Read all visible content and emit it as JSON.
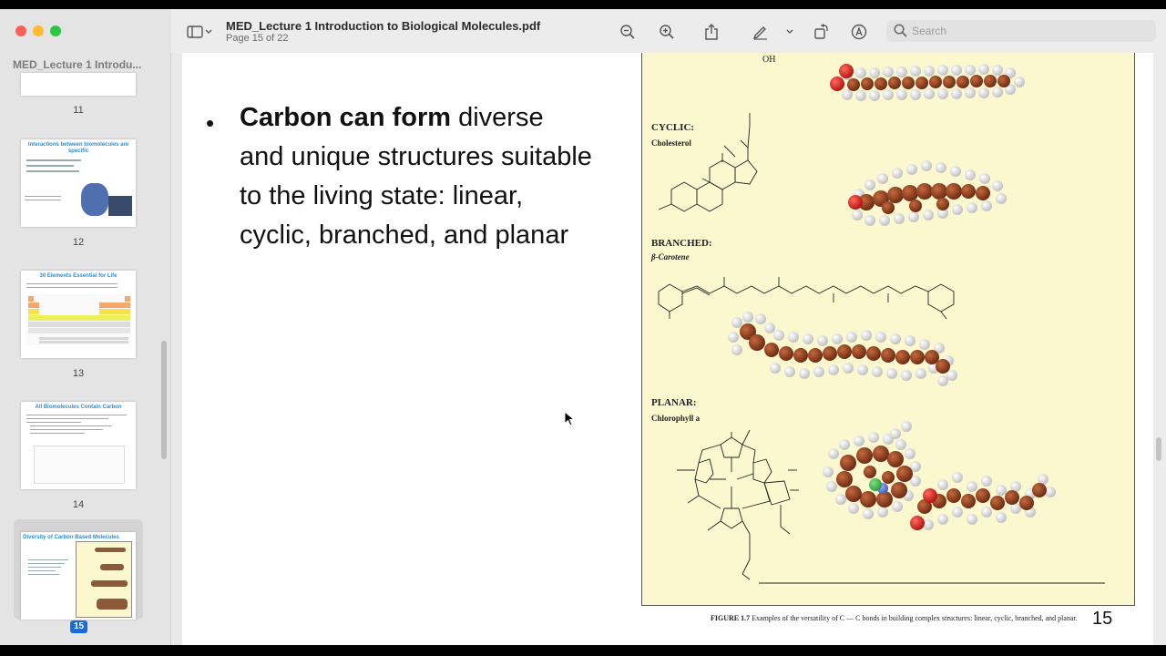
{
  "window": {
    "title": "MED_Lecture 1 Introduction to Biological Molecules.pdf",
    "page_indicator": "Page 15 of 22",
    "search_placeholder": "Search"
  },
  "toolbar": {
    "icons": [
      "sidebar-toggle-icon",
      "chevron-down-icon",
      "zoom-out-icon",
      "zoom-in-icon",
      "share-icon",
      "markup-pen-icon",
      "chevron-down-icon",
      "rotate-icon",
      "annotate-icon",
      "search-icon"
    ]
  },
  "sidebar": {
    "title": "MED_Lecture 1 Introdu...",
    "thumbnails": [
      {
        "page": "11",
        "title": ""
      },
      {
        "page": "12",
        "title": "Interactions between biomolecules are specific"
      },
      {
        "page": "13",
        "title": "30 Elements Essential for Life"
      },
      {
        "page": "14",
        "title": "All Biomolecules Contain Carbon"
      },
      {
        "page": "15",
        "title": "Diversity of Carbon Based Molecules",
        "selected": true
      }
    ]
  },
  "slide": {
    "bullet_bold": "Carbon can form",
    "bullet_rest": " diverse and unique structures suitable to the living state: linear, cyclic, branched, and planar",
    "page_number": "15",
    "figure": {
      "top_label": "OH",
      "cyclic_label": "CYCLIC:",
      "cyclic_name": "Cholesterol",
      "branched_label": "BRANCHED:",
      "branched_name": "β-Carotene",
      "planar_label": "PLANAR:",
      "planar_name": "Chlorophyll a",
      "caption_bold": "FIGURE 1.7",
      "caption_rest": " Examples of the versatility of C — C bonds in building complex structures: linear, cyclic, branched, and planar."
    }
  },
  "colors": {
    "figure_bg": "#fbf8d0",
    "carbon": "#8b3a1c",
    "hydrogen": "#f2f2f2",
    "oxygen": "#d81e1e",
    "selected_badge": "#1a6bd6"
  }
}
